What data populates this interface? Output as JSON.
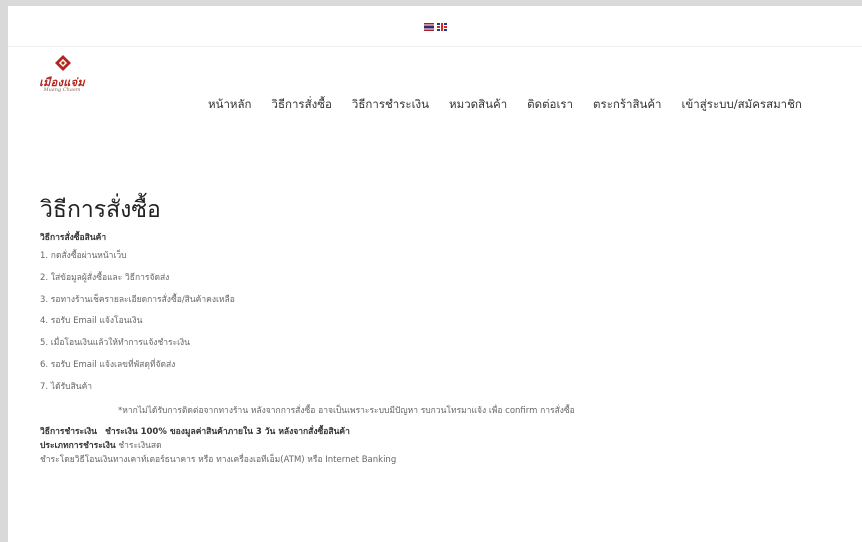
{
  "lang_bar": {
    "languages": [
      {
        "code": "th",
        "icon": "thai-flag-icon"
      },
      {
        "code": "en",
        "icon": "uk-flag-icon"
      }
    ]
  },
  "logo": {
    "icon": "diamond-logo-icon",
    "name": "เมืองแจ่ม",
    "tagline": "Muang Chaem",
    "accent": "#b3261e"
  },
  "nav": {
    "items": [
      "หน้าหลัก",
      "วิธีการสั่งซื้อ",
      "วิธีการชำระเงิน",
      "หมวดสินค้า",
      "ติดต่อเรา",
      "ตระกร้าสินค้า",
      "เข้าสู่ระบบ/สมัครสมาชิก"
    ]
  },
  "page": {
    "title": "วิธีการสั่งซื้อ",
    "section_heading": "วิธีการสั่งซื้อสินค้า",
    "steps": [
      "1. กดสั่งซื้อผ่านหน้าเว็บ",
      "2. ใส่ข้อมูลผู้สั่งซื้อและ วิธีการจัดส่ง",
      "3. รอทางร้านเช็ครายละเอียดการสั่งซื้อ/สินค้าคงเหลือ",
      "4. รอรับ Email แจ้งโอนเงิน",
      "5. เมื่อโอนเงินแล้วให้ทำการแจ้งชำระเงิน",
      "6. รอรับ Email แจ้งเลขที่พัสดุที่จัดส่ง",
      "7. ได้รับสินค้า"
    ],
    "note": "*หากไม่ได้รับการติดต่อจากทางร้าน หลังจากการสั่งซื้อ อาจเป็นเพราะระบบมีปัญหา รบกวนโทรมาแจ้ง เพื่อ confirm การสั่งซื้อ",
    "payment": {
      "label": "วิธีการชำระเงิน",
      "text": "ชำระเงิน 100% ของมูลค่าสินค้าภายใน 3 วัน หลังจากสั่งซื้อสินค้า",
      "type_label": "ประเภทการชำระเงิน",
      "type_value": "ชำระเงินสด",
      "description": "ชำระโดยวิธีโอนเงินทางเคาท์เตอร์ธนาคาร หรือ ทางเครื่องเอทีเอ็ม(ATM) หรือ Internet Banking"
    }
  }
}
